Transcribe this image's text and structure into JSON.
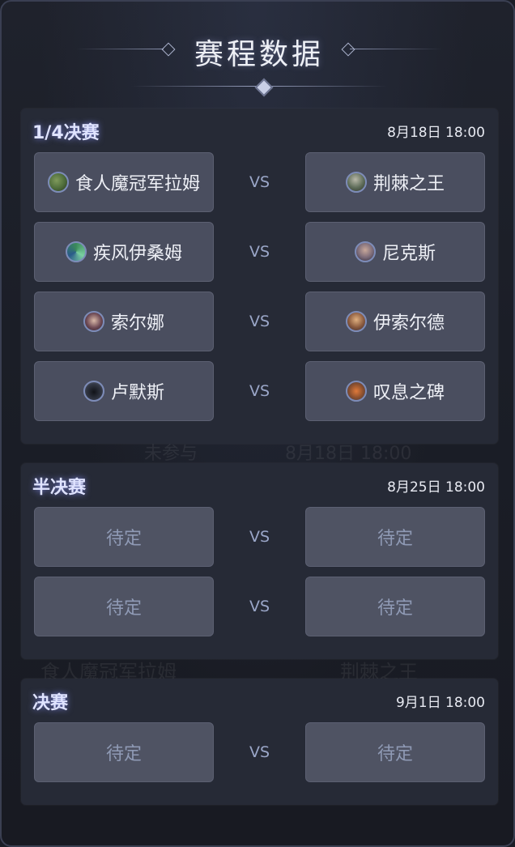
{
  "page": {
    "title": "赛程数据"
  },
  "background_text": {
    "left_a": "未参与",
    "date_a": "8月18日 18:00",
    "left_b": "食人魔冠军拉姆",
    "right_b": "荆棘之王"
  },
  "rounds": [
    {
      "name": "1/4决赛",
      "date": "8月18日 18:00",
      "matches": [
        {
          "left": {
            "name": "食人魔冠军拉姆",
            "icon": "ogre-avatar-icon",
            "color": "#4d6b3a"
          },
          "vs": "VS",
          "right": {
            "name": "荆棘之王",
            "icon": "thorn-king-avatar-icon",
            "color": "#5d6b58"
          }
        },
        {
          "left": {
            "name": "疾风伊桑姆",
            "icon": "gale-avatar-icon",
            "color": "#3b8a5a"
          },
          "vs": "VS",
          "right": {
            "name": "尼克斯",
            "icon": "nyx-avatar-icon",
            "color": "#7a6a78"
          }
        },
        {
          "left": {
            "name": "索尔娜",
            "icon": "solna-avatar-icon",
            "color": "#6e4a55"
          },
          "vs": "VS",
          "right": {
            "name": "伊索尔德",
            "icon": "isolde-avatar-icon",
            "color": "#8a5a3e"
          }
        },
        {
          "left": {
            "name": "卢默斯",
            "icon": "lumos-avatar-icon",
            "color": "#333845"
          },
          "vs": "VS",
          "right": {
            "name": "叹息之碑",
            "icon": "sigh-monument-avatar-icon",
            "color": "#8a4f2e"
          }
        }
      ]
    },
    {
      "name": "半决赛",
      "date": "8月25日 18:00",
      "matches": [
        {
          "left": {
            "name": "待定"
          },
          "vs": "VS",
          "right": {
            "name": "待定"
          }
        },
        {
          "left": {
            "name": "待定"
          },
          "vs": "VS",
          "right": {
            "name": "待定"
          }
        }
      ]
    },
    {
      "name": "决赛",
      "date": "9月1日 18:00",
      "matches": [
        {
          "left": {
            "name": "待定"
          },
          "vs": "VS",
          "right": {
            "name": "待定"
          }
        }
      ]
    }
  ],
  "colors": {
    "panel": "#262a36",
    "team_box": "#4a4e5f",
    "tbd_text": "#8f9ab5",
    "round_glow": "#8c96ff"
  }
}
